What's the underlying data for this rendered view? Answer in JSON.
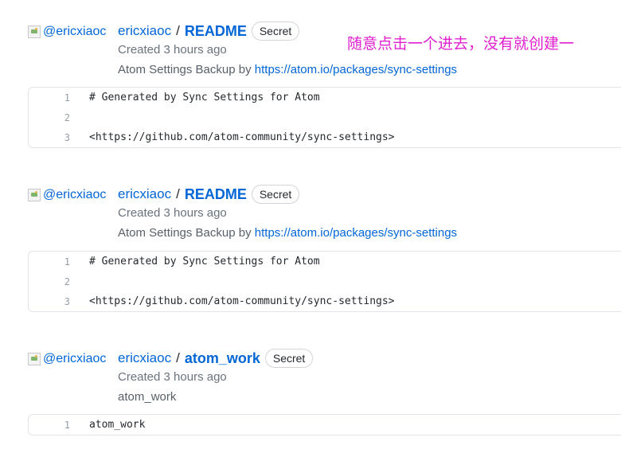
{
  "annotation": "随意点击一个进去，没有就创建一",
  "gists": [
    {
      "avatar_alt": "@ericxiaoc",
      "owner": "ericxiaoc",
      "separator": "/",
      "name": "README",
      "badge": "Secret",
      "created": "Created 3 hours ago",
      "description_text": "Atom Settings Backup by ",
      "description_link": "https://atom.io/packages/sync-settings",
      "lines": [
        {
          "num": "1",
          "code": "# Generated by Sync Settings for Atom"
        },
        {
          "num": "2",
          "code": ""
        },
        {
          "num": "3",
          "code": "<https://github.com/atom-community/sync-settings>"
        }
      ]
    },
    {
      "avatar_alt": "@ericxiaoc",
      "owner": "ericxiaoc",
      "separator": "/",
      "name": "README",
      "badge": "Secret",
      "created": "Created 3 hours ago",
      "description_text": "Atom Settings Backup by ",
      "description_link": "https://atom.io/packages/sync-settings",
      "lines": [
        {
          "num": "1",
          "code": "# Generated by Sync Settings for Atom"
        },
        {
          "num": "2",
          "code": ""
        },
        {
          "num": "3",
          "code": "<https://github.com/atom-community/sync-settings>"
        }
      ]
    },
    {
      "avatar_alt": "@ericxiaoc",
      "owner": "ericxiaoc",
      "separator": "/",
      "name": "atom_work",
      "badge": "Secret",
      "created": "Created 3 hours ago",
      "description_text": "atom_work",
      "description_link": "",
      "lines": [
        {
          "num": "1",
          "code": "atom_work"
        }
      ]
    }
  ]
}
